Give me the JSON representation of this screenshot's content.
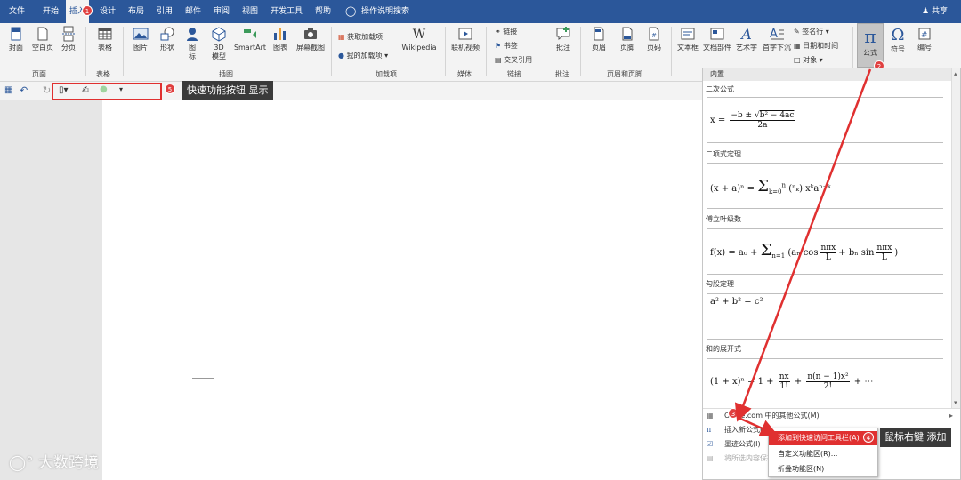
{
  "menubar": {
    "tabs": [
      "文件",
      "开始",
      "插入",
      "设计",
      "布局",
      "引用",
      "邮件",
      "审阅",
      "视图",
      "开发工具",
      "帮助"
    ],
    "tell_me": "操作说明搜索",
    "share": "共享"
  },
  "ribbon": {
    "pages": {
      "cover": "封面",
      "blank": "空白页",
      "break": "分页",
      "group": "页面"
    },
    "tables": {
      "table": "表格",
      "group": "表格"
    },
    "illus": {
      "picture": "图片",
      "shapes": "形状",
      "icons1": "图",
      "icons2": "标",
      "model1": "3D",
      "model2": "模型",
      "smartart": "SmartArt",
      "chart": "图表",
      "screenshot": "屏幕截图",
      "group": "插图"
    },
    "addins": {
      "get": "获取加载项",
      "my": "我的加载项",
      "wiki": "Wikipedia",
      "group": "加载项"
    },
    "media": {
      "video": "联机视频",
      "group": "媒体"
    },
    "links": {
      "link": "链接",
      "bookmark": "书签",
      "cross": "交叉引用",
      "group": "链接"
    },
    "comments": {
      "comment": "批注",
      "group": "批注"
    },
    "hf": {
      "header": "页眉",
      "footer": "页脚",
      "pagenum": "页码",
      "group": "页眉和页脚"
    },
    "text": {
      "textbox": "文本框",
      "quickparts": "文档部件",
      "wordart": "艺术字",
      "dropcap": "首字下沉",
      "sigline": "签名行",
      "datetime": "日期和时间",
      "object": "对象"
    },
    "symbols": {
      "equation": "公式",
      "symbol": "符号",
      "number": "编号"
    }
  },
  "callouts": {
    "qat": "快速功能按钮 显示",
    "rightclick": "鼠标右键 添加"
  },
  "badges": [
    "1",
    "2",
    "3",
    "4",
    "5"
  ],
  "panel": {
    "header": "内置",
    "sections": [
      {
        "title": "二次公式"
      },
      {
        "title": "二项式定理"
      },
      {
        "title": "傅立叶级数"
      },
      {
        "title": "勾股定理"
      },
      {
        "title": "和的展开式"
      }
    ],
    "menu": [
      "Office.com 中的其他公式(M)",
      "插入新公式(I)",
      "墨迹公式(I)",
      "将所选内容保存到公式库(S)..."
    ]
  },
  "context_menu": [
    "添加到快速访问工具栏(A)",
    "自定义功能区(R)...",
    "折叠功能区(N)"
  ],
  "watermark": "大数跨境",
  "colors": {
    "accent": "#2b579a",
    "badge": "#e04040",
    "arrow": "#e03030"
  }
}
